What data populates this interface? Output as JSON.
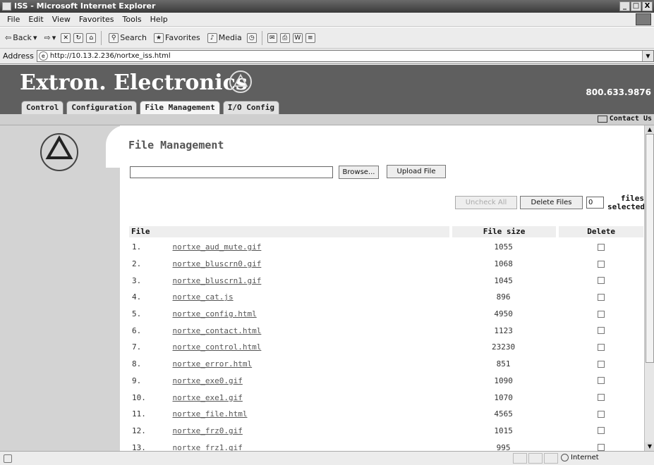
{
  "window": {
    "title": "ISS - Microsoft Internet Explorer",
    "buttons": [
      "_",
      "□",
      "X"
    ]
  },
  "menu": [
    "File",
    "Edit",
    "View",
    "Favorites",
    "Tools",
    "Help"
  ],
  "toolbar": {
    "back": "Back",
    "search": "Search",
    "favorites": "Favorites",
    "media": "Media"
  },
  "address": {
    "label": "Address",
    "url": "http://10.13.2.236/nortxe_iss.html"
  },
  "banner": {
    "brand": "Extron. Electronics",
    "phone": "800.633.9876",
    "tabs": [
      "Control",
      "Configuration",
      "File Management",
      "I/O Config"
    ],
    "active_tab": "File Management"
  },
  "contact": "Contact Us",
  "main": {
    "title": "File Management",
    "browse_label": "Browse...",
    "upload_label": "Upload File",
    "uncheck_all_label": "Uncheck All",
    "delete_files_label": "Delete Files",
    "files_selected_count": "0",
    "files_selected_label": "files selected",
    "columns": {
      "file": "File",
      "size": "File size",
      "delete": "Delete"
    },
    "files": [
      {
        "num": "1.",
        "name": "nortxe_aud_mute.gif",
        "size": "1055"
      },
      {
        "num": "2.",
        "name": "nortxe_bluscrn0.gif",
        "size": "1068"
      },
      {
        "num": "3.",
        "name": "nortxe_bluscrn1.gif",
        "size": "1045"
      },
      {
        "num": "4.",
        "name": "nortxe_cat.js",
        "size": "896"
      },
      {
        "num": "5.",
        "name": "nortxe_config.html",
        "size": "4950"
      },
      {
        "num": "6.",
        "name": "nortxe_contact.html",
        "size": "1123"
      },
      {
        "num": "7.",
        "name": "nortxe_control.html",
        "size": "23230"
      },
      {
        "num": "8.",
        "name": "nortxe_error.html",
        "size": "851"
      },
      {
        "num": "9.",
        "name": "nortxe_exe0.gif",
        "size": "1090"
      },
      {
        "num": "10.",
        "name": "nortxe_exe1.gif",
        "size": "1070"
      },
      {
        "num": "11.",
        "name": "nortxe_file.html",
        "size": "4565"
      },
      {
        "num": "12.",
        "name": "nortxe_frz0.gif",
        "size": "1015"
      },
      {
        "num": "13.",
        "name": "nortxe_frz1.gif",
        "size": "995"
      }
    ]
  },
  "status": {
    "zone": "Internet"
  }
}
